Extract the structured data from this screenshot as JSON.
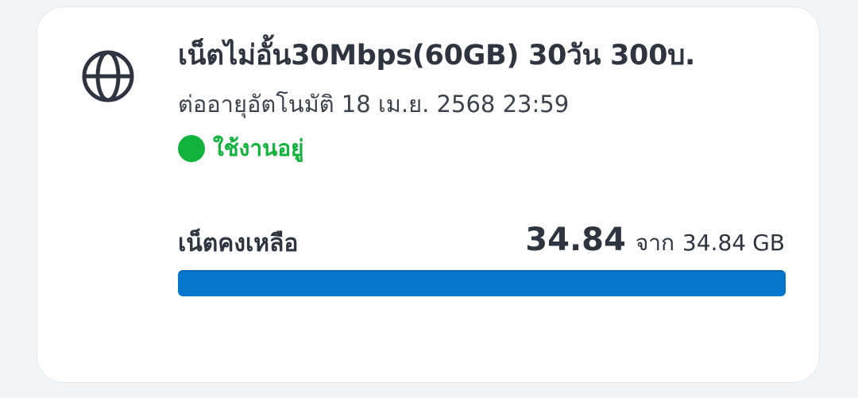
{
  "package": {
    "icon": "globe-icon",
    "title": "เน็ตไม่อั้น30Mbps(60GB) 30วัน 300บ.",
    "renewal_text": "ต่ออายุอัตโนมัติ 18 เม.ย. 2568 23:59",
    "status": {
      "label": "ใช้งานอยู่",
      "color": "#12b33c"
    }
  },
  "data_remaining": {
    "label": "เน็ตคงเหลือ",
    "remaining": "34.84",
    "of_label": "จาก",
    "total": "34.84",
    "unit": "GB",
    "fraction": 1.0,
    "bar_color": "#0676cc"
  }
}
